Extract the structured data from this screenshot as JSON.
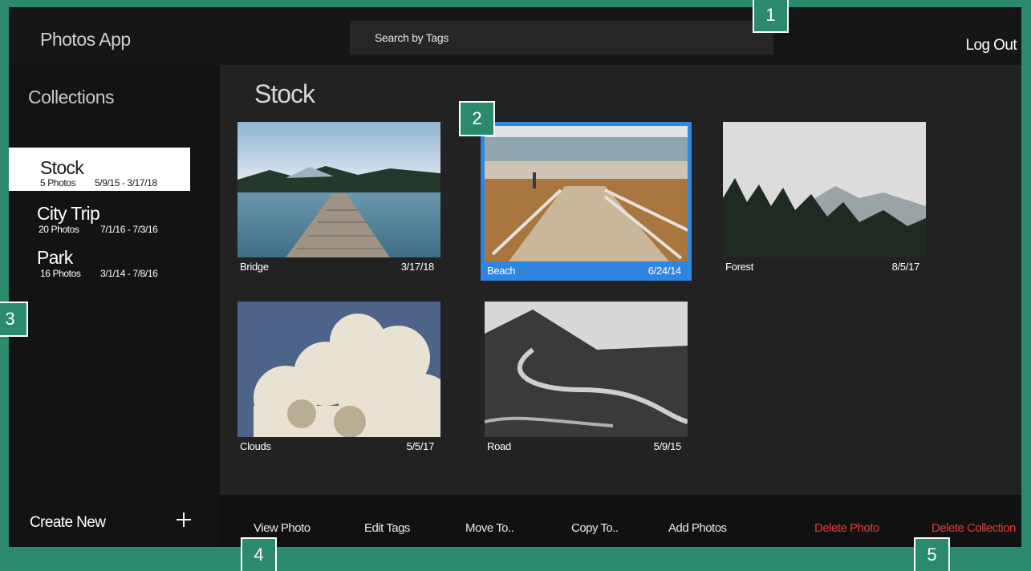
{
  "app": {
    "title": "Photos App"
  },
  "search": {
    "placeholder": "Search by Tags"
  },
  "header": {
    "logout_label": "Log Out"
  },
  "sidebar": {
    "title": "Collections",
    "collections": [
      {
        "name": "Stock",
        "count": "5 Photos",
        "range": "5/9/15 - 3/17/18",
        "active": true
      },
      {
        "name": "City Trip",
        "count": "20 Photos",
        "range": "7/1/16 - 7/3/16",
        "active": false
      },
      {
        "name": "Park",
        "count": "16 Photos",
        "range": "3/1/14 - 7/8/16",
        "active": false
      }
    ],
    "create_label": "Create New",
    "create_icon": "plus-icon"
  },
  "main": {
    "title": "Stock",
    "photos": [
      {
        "name": "Bridge",
        "date": "3/17/18",
        "selected": false
      },
      {
        "name": "Beach",
        "date": "6/24/14",
        "selected": true
      },
      {
        "name": "Forest",
        "date": "8/5/17",
        "selected": false
      },
      {
        "name": "Clouds",
        "date": "5/5/17",
        "selected": false
      },
      {
        "name": "Road",
        "date": "5/9/15",
        "selected": false
      }
    ]
  },
  "toolbar": {
    "view_photo": "View Photo",
    "edit_tags": "Edit Tags",
    "move_to": "Move To..",
    "copy_to": "Copy To..",
    "add_photos": "Add Photos",
    "delete_photo": "Delete Photo",
    "delete_collection": "Delete Collection"
  },
  "annotations": {
    "labels": [
      "1",
      "2",
      "3",
      "4",
      "5"
    ]
  },
  "colors": {
    "accent": "#2b8a6e",
    "selection": "#2f86e0",
    "danger": "#e23b3b"
  }
}
